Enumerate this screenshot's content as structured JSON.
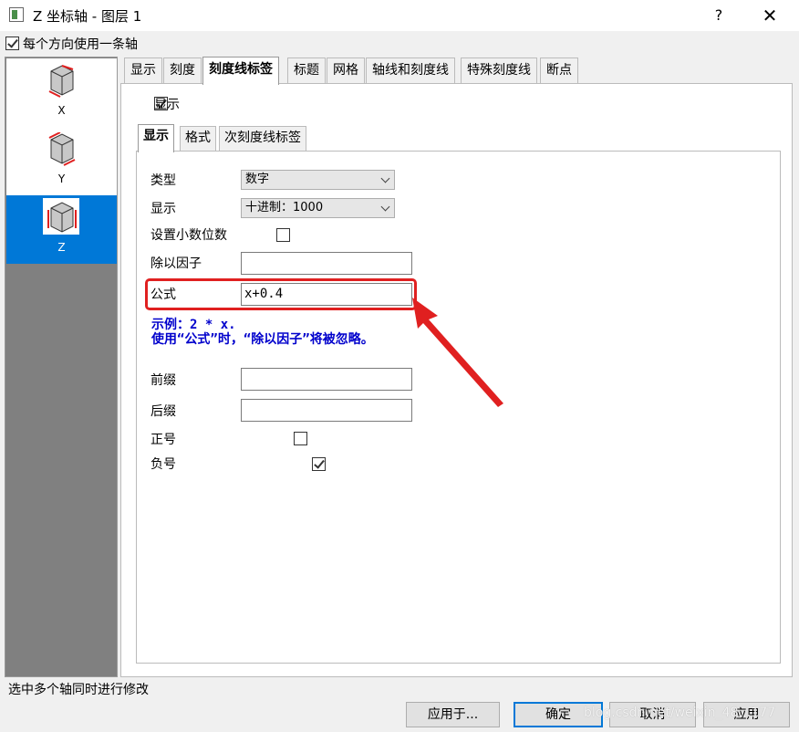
{
  "window": {
    "title": "Z 坐标轴 - 图层 1",
    "help": "?",
    "close": "✕"
  },
  "one_axis_per_direction": {
    "label": "每个方向使用一条轴",
    "checked": true
  },
  "axis_list": [
    {
      "label": "X",
      "selected": false
    },
    {
      "label": "Y",
      "selected": false
    },
    {
      "label": "Z",
      "selected": true
    }
  ],
  "tabs": [
    "显示",
    "刻度",
    "刻度线标签",
    "标题",
    "网格",
    "轴线和刻度线",
    "特殊刻度线",
    "断点"
  ],
  "active_tab": "刻度线标签",
  "show": {
    "label": "显示",
    "checked": true
  },
  "inner_tabs": [
    "显示",
    "格式",
    "次刻度线标签"
  ],
  "active_inner_tab": "显示",
  "form": {
    "type_label": "类型",
    "type_value": "数字",
    "display_label": "显示",
    "display_value": "十进制：1000",
    "set_decimal_label": "设置小数位数",
    "set_decimal_checked": false,
    "divide_label": "除以因子",
    "divide_value": "",
    "formula_label": "公式",
    "formula_value": "x+0.4",
    "hint_line1": "示例：2 * x.",
    "hint_line2": "使用“公式”时，“除以因子”将被忽略。",
    "prefix_label": "前缀",
    "prefix_value": "",
    "suffix_label": "后缀",
    "suffix_value": "",
    "plus_label": "正号",
    "plus_checked": false,
    "minus_label": "负号",
    "minus_checked": true
  },
  "status": "选中多个轴同时进行修改",
  "buttons": {
    "apply_to": "应用于...",
    "ok": "确定",
    "cancel": "取消",
    "apply": "应用"
  },
  "watermark": "blog.csdn.net/weixin_48…177",
  "colors": {
    "accent": "#0078d7",
    "hint": "#0000cc",
    "annotation": "#e02020"
  }
}
